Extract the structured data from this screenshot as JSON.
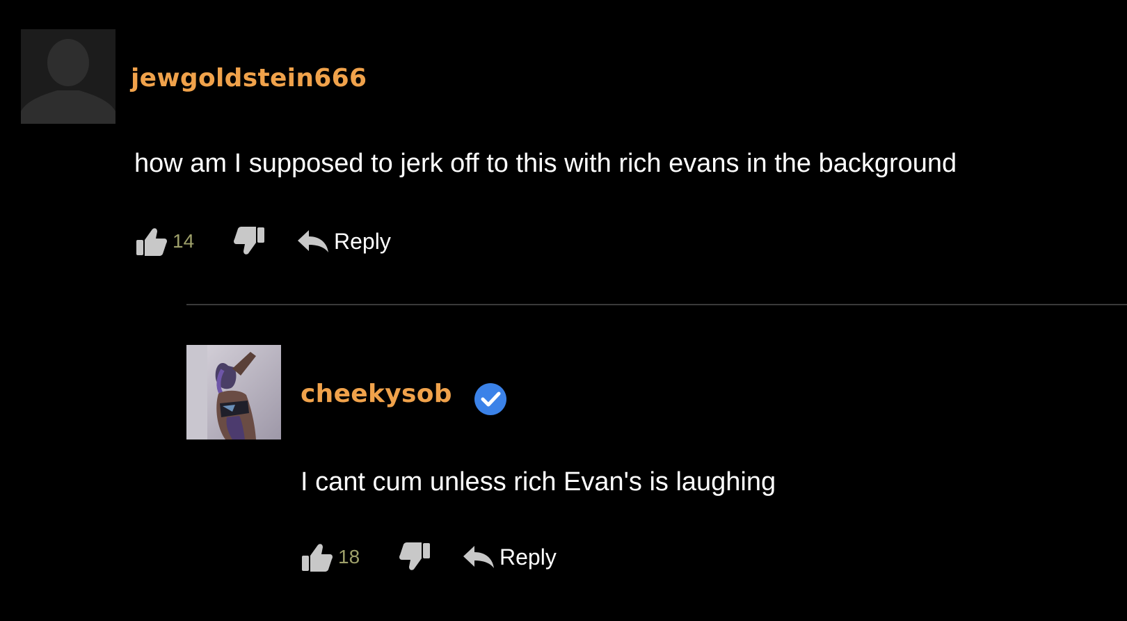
{
  "comments": [
    {
      "username": "jewgoldstein666",
      "verified": false,
      "text": "how am I supposed to jerk off to this with rich evans in the background",
      "likes": "14",
      "reply_label": "Reply",
      "avatar_icon": "default-user-silhouette-icon"
    },
    {
      "username": "cheekysob",
      "verified": true,
      "text": "I cant cum unless rich Evan's is laughing",
      "likes": "18",
      "reply_label": "Reply",
      "avatar_icon": "user-photo"
    }
  ],
  "icons": {
    "like": "thumbs-up-icon",
    "dislike": "thumbs-down-icon",
    "reply": "reply-arrow-icon",
    "verified": "verified-check-icon"
  },
  "colors": {
    "background": "#000000",
    "username": "#f0a24b",
    "vote_count": "#9ea06a",
    "icon": "#c8c8c8",
    "verified_badge": "#3b82e8",
    "divider": "#3a3a3a"
  }
}
